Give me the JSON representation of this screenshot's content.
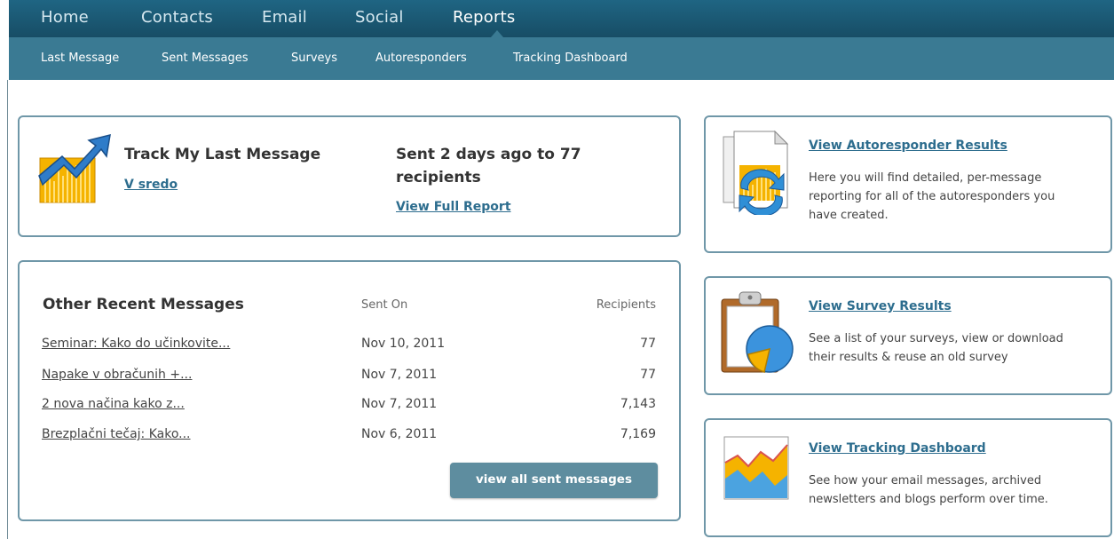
{
  "nav": {
    "main": [
      "Home",
      "Contacts",
      "Email",
      "Social",
      "Reports"
    ],
    "active": "Reports",
    "sub": [
      "Last Message",
      "Sent Messages",
      "Surveys",
      "Autoresponders",
      "Tracking Dashboard"
    ]
  },
  "track": {
    "title": "Track My Last Message",
    "message_link": "V sredo",
    "sent_line1": "Sent 2 days ago to 77",
    "sent_line2": "recipients",
    "report_link": "View Full Report"
  },
  "recent": {
    "title": "Other Recent Messages",
    "col_sent": "Sent On",
    "col_recipients": "Recipients",
    "rows": [
      {
        "name": "Seminar: Kako do učinkovite...",
        "date": "Nov 10, 2011",
        "recipients": "77"
      },
      {
        "name": "Napake v obračunih +...",
        "date": "Nov 7, 2011",
        "recipients": "77"
      },
      {
        "name": "2 nova načina kako z...",
        "date": "Nov 7, 2011",
        "recipients": "7,143"
      },
      {
        "name": "Brezplačni tečaj: Kako...",
        "date": "Nov 6, 2011",
        "recipients": "7,169"
      }
    ],
    "button": "view all sent messages"
  },
  "cards": [
    {
      "link": "View Autoresponder Results",
      "desc": [
        "Here you will find detailed, per-message",
        "reporting for all of the autoresponders you",
        "have created."
      ],
      "icon": "autoresponder-icon"
    },
    {
      "link": "View Survey Results",
      "desc": [
        "See a list of your surveys, view or download",
        "their results & reuse an old survey"
      ],
      "icon": "clipboard-pie-icon"
    },
    {
      "link": "View Tracking Dashboard",
      "desc": [
        "See how your email messages, archived",
        "newsletters and blogs perform over time."
      ],
      "icon": "tracking-chart-icon"
    }
  ]
}
